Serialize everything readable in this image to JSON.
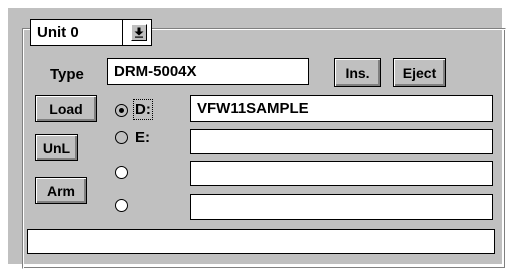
{
  "unit_select": {
    "value": "Unit 0",
    "arrow_icon": "down-arrow-icon"
  },
  "type": {
    "label": "Type",
    "value": "DRM-5004X"
  },
  "buttons": {
    "insert": "Ins.",
    "eject": "Eject",
    "load": "Load",
    "unload": "UnL",
    "arm": "Arm"
  },
  "drives": [
    {
      "label": "D:",
      "selected": true,
      "value": "VFW11SAMPLE"
    },
    {
      "label": "E:",
      "selected": false,
      "value": ""
    },
    {
      "label": "",
      "selected": false,
      "value": ""
    },
    {
      "label": "",
      "selected": false,
      "value": ""
    }
  ],
  "status": {
    "value": ""
  }
}
